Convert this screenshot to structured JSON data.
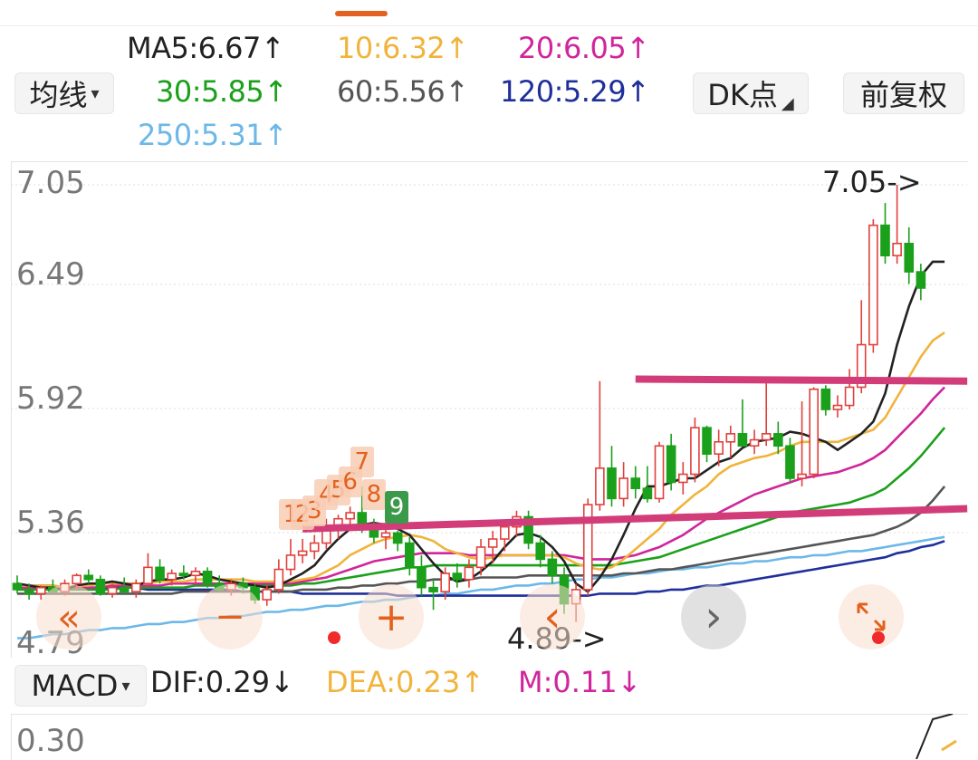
{
  "toolbar": {
    "ma_type_label": "均线",
    "dk_label": "DK点",
    "adjust_label": "前复权"
  },
  "ma_legend": [
    {
      "label": "MA5:6.67↑",
      "color": "#222222"
    },
    {
      "label": "10:6.32↑",
      "color": "#f0b43c"
    },
    {
      "label": "20:6.05↑",
      "color": "#d0259c"
    },
    {
      "label": "30:5.85↑",
      "color": "#1aa01a"
    },
    {
      "label": "60:5.56↑",
      "color": "#555555"
    },
    {
      "label": "120:5.29↑",
      "color": "#1f2f9a"
    },
    {
      "label": "250:5.31↑",
      "color": "#6cb8e8"
    }
  ],
  "price_axis": {
    "ticks": [
      "7.05",
      "6.49",
      "5.92",
      "5.36",
      "4.79"
    ]
  },
  "annotations": {
    "high_label": "7.05->",
    "low_label": "4.89->"
  },
  "td_count_labels": [
    "1",
    "2",
    "3",
    "4",
    "5",
    "6",
    "7",
    "8"
  ],
  "td_sell_label": "9",
  "overlay_controls": {
    "rewind_icon": "«",
    "minus_icon": "−",
    "plus_icon": "+",
    "prev_icon": "‹",
    "next_icon": "›"
  },
  "macd": {
    "indicator_label": "MACD",
    "dif_label": "DIF:0.29↓",
    "dea_label": "DEA:0.23↑",
    "m_label": "M:0.11↓",
    "axis_top": "0.30"
  },
  "colors": {
    "up": "#e0403c",
    "down": "#1aa01a",
    "trendline": "#d23c78",
    "accent": "#e2611e"
  },
  "chart_data": {
    "type": "candlestick",
    "y_range": [
      4.79,
      7.05
    ],
    "grid": true,
    "candles": [
      {
        "o": 5.08,
        "h": 5.12,
        "l": 5.03,
        "c": 5.05
      },
      {
        "o": 5.05,
        "h": 5.08,
        "l": 5.0,
        "c": 5.03
      },
      {
        "o": 5.03,
        "h": 5.07,
        "l": 5.0,
        "c": 5.06
      },
      {
        "o": 5.06,
        "h": 5.1,
        "l": 5.04,
        "c": 5.04
      },
      {
        "o": 5.04,
        "h": 5.1,
        "l": 5.02,
        "c": 5.08
      },
      {
        "o": 5.08,
        "h": 5.13,
        "l": 5.05,
        "c": 5.12
      },
      {
        "o": 5.12,
        "h": 5.15,
        "l": 5.08,
        "c": 5.1
      },
      {
        "o": 5.1,
        "h": 5.12,
        "l": 5.02,
        "c": 5.03
      },
      {
        "o": 5.03,
        "h": 5.08,
        "l": 5.01,
        "c": 5.06
      },
      {
        "o": 5.06,
        "h": 5.11,
        "l": 5.03,
        "c": 5.04
      },
      {
        "o": 5.04,
        "h": 5.1,
        "l": 5.01,
        "c": 5.08
      },
      {
        "o": 5.08,
        "h": 5.23,
        "l": 5.06,
        "c": 5.16
      },
      {
        "o": 5.16,
        "h": 5.2,
        "l": 5.08,
        "c": 5.1
      },
      {
        "o": 5.1,
        "h": 5.15,
        "l": 5.07,
        "c": 5.13
      },
      {
        "o": 5.13,
        "h": 5.17,
        "l": 5.1,
        "c": 5.12
      },
      {
        "o": 5.12,
        "h": 5.16,
        "l": 5.08,
        "c": 5.14
      },
      {
        "o": 5.14,
        "h": 5.16,
        "l": 5.06,
        "c": 5.08
      },
      {
        "o": 5.08,
        "h": 5.12,
        "l": 5.04,
        "c": 5.05
      },
      {
        "o": 5.05,
        "h": 5.1,
        "l": 5.02,
        "c": 5.08
      },
      {
        "o": 5.08,
        "h": 5.11,
        "l": 5.03,
        "c": 5.06
      },
      {
        "o": 5.06,
        "h": 5.08,
        "l": 4.98,
        "c": 5.0
      },
      {
        "o": 5.0,
        "h": 5.07,
        "l": 4.97,
        "c": 5.05
      },
      {
        "o": 5.05,
        "h": 5.2,
        "l": 5.03,
        "c": 5.15
      },
      {
        "o": 5.15,
        "h": 5.3,
        "l": 5.12,
        "c": 5.22
      },
      {
        "o": 5.22,
        "h": 5.3,
        "l": 5.18,
        "c": 5.24
      },
      {
        "o": 5.24,
        "h": 5.32,
        "l": 5.2,
        "c": 5.28
      },
      {
        "o": 5.28,
        "h": 5.4,
        "l": 5.25,
        "c": 5.36
      },
      {
        "o": 5.36,
        "h": 5.42,
        "l": 5.3,
        "c": 5.4
      },
      {
        "o": 5.4,
        "h": 5.46,
        "l": 5.34,
        "c": 5.43
      },
      {
        "o": 5.43,
        "h": 5.56,
        "l": 5.33,
        "c": 5.36
      },
      {
        "o": 5.36,
        "h": 5.4,
        "l": 5.28,
        "c": 5.31
      },
      {
        "o": 5.31,
        "h": 5.36,
        "l": 5.25,
        "c": 5.33
      },
      {
        "o": 5.33,
        "h": 5.34,
        "l": 5.24,
        "c": 5.28
      },
      {
        "o": 5.28,
        "h": 5.31,
        "l": 5.12,
        "c": 5.16
      },
      {
        "o": 5.16,
        "h": 5.22,
        "l": 5.02,
        "c": 5.06
      },
      {
        "o": 5.06,
        "h": 5.1,
        "l": 4.95,
        "c": 5.04
      },
      {
        "o": 5.04,
        "h": 5.16,
        "l": 5.0,
        "c": 5.13
      },
      {
        "o": 5.13,
        "h": 5.18,
        "l": 5.06,
        "c": 5.1
      },
      {
        "o": 5.1,
        "h": 5.2,
        "l": 5.06,
        "c": 5.16
      },
      {
        "o": 5.16,
        "h": 5.3,
        "l": 5.12,
        "c": 5.26
      },
      {
        "o": 5.26,
        "h": 5.34,
        "l": 5.18,
        "c": 5.3
      },
      {
        "o": 5.3,
        "h": 5.38,
        "l": 5.24,
        "c": 5.36
      },
      {
        "o": 5.36,
        "h": 5.44,
        "l": 5.31,
        "c": 5.41
      },
      {
        "o": 5.41,
        "h": 5.44,
        "l": 5.25,
        "c": 5.28
      },
      {
        "o": 5.28,
        "h": 5.32,
        "l": 5.16,
        "c": 5.2
      },
      {
        "o": 5.2,
        "h": 5.24,
        "l": 5.08,
        "c": 5.12
      },
      {
        "o": 5.12,
        "h": 5.16,
        "l": 4.93,
        "c": 4.98
      },
      {
        "o": 4.98,
        "h": 5.08,
        "l": 4.89,
        "c": 5.05
      },
      {
        "o": 5.05,
        "h": 5.5,
        "l": 5.02,
        "c": 5.47
      },
      {
        "o": 5.47,
        "h": 6.08,
        "l": 5.44,
        "c": 5.65
      },
      {
        "o": 5.65,
        "h": 5.76,
        "l": 5.46,
        "c": 5.5
      },
      {
        "o": 5.5,
        "h": 5.68,
        "l": 5.46,
        "c": 5.6
      },
      {
        "o": 5.6,
        "h": 5.66,
        "l": 5.5,
        "c": 5.55
      },
      {
        "o": 5.55,
        "h": 5.66,
        "l": 5.48,
        "c": 5.5
      },
      {
        "o": 5.5,
        "h": 5.78,
        "l": 5.48,
        "c": 5.76
      },
      {
        "o": 5.76,
        "h": 5.82,
        "l": 5.54,
        "c": 5.58
      },
      {
        "o": 5.58,
        "h": 5.68,
        "l": 5.52,
        "c": 5.62
      },
      {
        "o": 5.62,
        "h": 5.9,
        "l": 5.58,
        "c": 5.85
      },
      {
        "o": 5.85,
        "h": 5.86,
        "l": 5.68,
        "c": 5.72
      },
      {
        "o": 5.72,
        "h": 5.84,
        "l": 5.66,
        "c": 5.78
      },
      {
        "o": 5.78,
        "h": 5.86,
        "l": 5.7,
        "c": 5.82
      },
      {
        "o": 5.82,
        "h": 5.99,
        "l": 5.76,
        "c": 5.76
      },
      {
        "o": 5.76,
        "h": 5.84,
        "l": 5.72,
        "c": 5.79
      },
      {
        "o": 5.79,
        "h": 6.08,
        "l": 5.76,
        "c": 5.82
      },
      {
        "o": 5.82,
        "h": 5.88,
        "l": 5.72,
        "c": 5.76
      },
      {
        "o": 5.76,
        "h": 5.8,
        "l": 5.58,
        "c": 5.6
      },
      {
        "o": 5.6,
        "h": 5.98,
        "l": 5.56,
        "c": 5.62
      },
      {
        "o": 5.62,
        "h": 6.05,
        "l": 5.6,
        "c": 6.04
      },
      {
        "o": 6.04,
        "h": 6.06,
        "l": 5.91,
        "c": 5.94
      },
      {
        "o": 5.94,
        "h": 6.01,
        "l": 5.9,
        "c": 5.96
      },
      {
        "o": 5.96,
        "h": 6.14,
        "l": 5.94,
        "c": 6.05
      },
      {
        "o": 6.05,
        "h": 6.48,
        "l": 6.02,
        "c": 6.26
      },
      {
        "o": 6.26,
        "h": 6.88,
        "l": 6.22,
        "c": 6.85
      },
      {
        "o": 6.85,
        "h": 6.96,
        "l": 6.66,
        "c": 6.7
      },
      {
        "o": 6.7,
        "h": 7.05,
        "l": 6.66,
        "c": 6.76
      },
      {
        "o": 6.76,
        "h": 6.84,
        "l": 6.56,
        "c": 6.62
      },
      {
        "o": 6.62,
        "h": 6.66,
        "l": 6.48,
        "c": 6.54
      }
    ],
    "td_setup": {
      "count_start_index": 23,
      "sell_nine_index": 31
    },
    "high": {
      "index": 75,
      "value": 7.05
    },
    "low": {
      "index": 47,
      "value": 4.89
    },
    "trendlines": [
      {
        "from": {
          "index": 24,
          "value": 5.35
        },
        "to": {
          "index": 78,
          "value": 5.45
        }
      },
      {
        "from": {
          "index": 52,
          "value": 6.09
        },
        "to": {
          "index": 78,
          "value": 6.08
        }
      }
    ],
    "series": [
      {
        "name": "MA5",
        "color": "#222222",
        "values": [
          5.08,
          5.07,
          5.06,
          5.06,
          5.05,
          5.07,
          5.08,
          5.08,
          5.09,
          5.08,
          5.07,
          5.09,
          5.1,
          5.1,
          5.11,
          5.13,
          5.12,
          5.1,
          5.09,
          5.08,
          5.07,
          5.06,
          5.07,
          5.1,
          5.13,
          5.17,
          5.24,
          5.3,
          5.35,
          5.37,
          5.38,
          5.37,
          5.35,
          5.32,
          5.25,
          5.18,
          5.12,
          5.09,
          5.1,
          5.14,
          5.19,
          5.26,
          5.32,
          5.33,
          5.31,
          5.26,
          5.19,
          5.08,
          5.04,
          5.11,
          5.2,
          5.32,
          5.45,
          5.56,
          5.56,
          5.58,
          5.6,
          5.6,
          5.64,
          5.68,
          5.7,
          5.75,
          5.78,
          5.79,
          5.8,
          5.83,
          5.82,
          5.8,
          5.78,
          5.74,
          5.78,
          5.82,
          5.88,
          6.02,
          6.26,
          6.45,
          6.6,
          6.67,
          6.67
        ]
      },
      {
        "name": "10",
        "color": "#f0b43c",
        "values": [
          5.07,
          5.07,
          5.07,
          5.07,
          5.06,
          5.07,
          5.07,
          5.08,
          5.08,
          5.08,
          5.08,
          5.08,
          5.09,
          5.09,
          5.09,
          5.1,
          5.1,
          5.1,
          5.1,
          5.1,
          5.09,
          5.09,
          5.09,
          5.09,
          5.1,
          5.11,
          5.14,
          5.17,
          5.22,
          5.25,
          5.28,
          5.3,
          5.31,
          5.32,
          5.31,
          5.29,
          5.25,
          5.23,
          5.21,
          5.2,
          5.21,
          5.22,
          5.22,
          5.22,
          5.22,
          5.22,
          5.21,
          5.18,
          5.16,
          5.15,
          5.16,
          5.2,
          5.25,
          5.3,
          5.35,
          5.42,
          5.47,
          5.52,
          5.56,
          5.62,
          5.66,
          5.68,
          5.7,
          5.71,
          5.73,
          5.76,
          5.78,
          5.78,
          5.78,
          5.78,
          5.8,
          5.82,
          5.84,
          5.9,
          6.0,
          6.1,
          6.2,
          6.28,
          6.32
        ]
      },
      {
        "name": "20",
        "color": "#d0259c",
        "values": [
          5.06,
          5.06,
          5.06,
          5.06,
          5.06,
          5.06,
          5.06,
          5.06,
          5.07,
          5.07,
          5.07,
          5.07,
          5.07,
          5.08,
          5.08,
          5.08,
          5.08,
          5.08,
          5.08,
          5.08,
          5.08,
          5.08,
          5.08,
          5.08,
          5.09,
          5.1,
          5.11,
          5.13,
          5.15,
          5.17,
          5.19,
          5.2,
          5.21,
          5.22,
          5.23,
          5.23,
          5.23,
          5.23,
          5.22,
          5.22,
          5.22,
          5.22,
          5.22,
          5.22,
          5.22,
          5.22,
          5.22,
          5.21,
          5.2,
          5.2,
          5.2,
          5.21,
          5.22,
          5.24,
          5.26,
          5.29,
          5.32,
          5.36,
          5.4,
          5.43,
          5.46,
          5.49,
          5.52,
          5.54,
          5.56,
          5.58,
          5.6,
          5.61,
          5.62,
          5.63,
          5.65,
          5.67,
          5.7,
          5.74,
          5.8,
          5.86,
          5.92,
          5.99,
          6.05
        ]
      },
      {
        "name": "30",
        "color": "#1aa01a",
        "values": [
          5.05,
          5.05,
          5.05,
          5.05,
          5.05,
          5.05,
          5.05,
          5.05,
          5.05,
          5.06,
          5.06,
          5.06,
          5.06,
          5.06,
          5.06,
          5.07,
          5.07,
          5.07,
          5.07,
          5.07,
          5.07,
          5.07,
          5.07,
          5.07,
          5.08,
          5.08,
          5.09,
          5.1,
          5.11,
          5.12,
          5.13,
          5.14,
          5.15,
          5.16,
          5.16,
          5.17,
          5.17,
          5.17,
          5.17,
          5.17,
          5.17,
          5.17,
          5.17,
          5.17,
          5.17,
          5.17,
          5.17,
          5.17,
          5.17,
          5.17,
          5.17,
          5.18,
          5.19,
          5.2,
          5.21,
          5.23,
          5.25,
          5.27,
          5.29,
          5.31,
          5.33,
          5.35,
          5.37,
          5.39,
          5.41,
          5.43,
          5.44,
          5.45,
          5.46,
          5.47,
          5.48,
          5.5,
          5.52,
          5.55,
          5.6,
          5.65,
          5.71,
          5.78,
          5.85
        ]
      },
      {
        "name": "60",
        "color": "#555555",
        "values": [
          5.03,
          5.03,
          5.03,
          5.03,
          5.03,
          5.03,
          5.03,
          5.03,
          5.03,
          5.03,
          5.03,
          5.03,
          5.03,
          5.03,
          5.04,
          5.04,
          5.04,
          5.04,
          5.04,
          5.04,
          5.04,
          5.04,
          5.04,
          5.04,
          5.05,
          5.05,
          5.05,
          5.06,
          5.06,
          5.07,
          5.07,
          5.08,
          5.08,
          5.09,
          5.09,
          5.1,
          5.1,
          5.1,
          5.1,
          5.11,
          5.11,
          5.11,
          5.11,
          5.12,
          5.12,
          5.12,
          5.12,
          5.12,
          5.12,
          5.12,
          5.12,
          5.13,
          5.13,
          5.14,
          5.15,
          5.15,
          5.16,
          5.17,
          5.18,
          5.19,
          5.2,
          5.21,
          5.22,
          5.23,
          5.24,
          5.25,
          5.26,
          5.27,
          5.28,
          5.29,
          5.3,
          5.31,
          5.32,
          5.34,
          5.36,
          5.39,
          5.43,
          5.49,
          5.56
        ]
      },
      {
        "name": "120",
        "color": "#1f2f9a",
        "values": [
          5.07,
          5.07,
          5.07,
          5.07,
          5.06,
          5.06,
          5.06,
          5.06,
          5.06,
          5.06,
          5.06,
          5.05,
          5.05,
          5.05,
          5.05,
          5.05,
          5.05,
          5.05,
          5.05,
          5.04,
          5.04,
          5.04,
          5.04,
          5.04,
          5.03,
          5.03,
          5.03,
          5.03,
          5.03,
          5.03,
          5.03,
          5.03,
          5.02,
          5.02,
          5.02,
          5.02,
          5.02,
          5.02,
          5.02,
          5.02,
          5.02,
          5.02,
          5.02,
          5.02,
          5.02,
          5.02,
          5.02,
          5.02,
          5.02,
          5.03,
          5.03,
          5.03,
          5.03,
          5.04,
          5.04,
          5.05,
          5.05,
          5.06,
          5.07,
          5.07,
          5.08,
          5.09,
          5.1,
          5.11,
          5.12,
          5.13,
          5.14,
          5.15,
          5.16,
          5.17,
          5.18,
          5.19,
          5.2,
          5.21,
          5.23,
          5.24,
          5.26,
          5.27,
          5.29
        ]
      },
      {
        "name": "250",
        "color": "#6cb8e8",
        "values": [
          4.81,
          4.81,
          4.82,
          4.83,
          4.83,
          4.84,
          4.85,
          4.85,
          4.86,
          4.86,
          4.87,
          4.88,
          4.88,
          4.89,
          4.89,
          4.9,
          4.91,
          4.91,
          4.92,
          4.92,
          4.93,
          4.94,
          4.94,
          4.95,
          4.95,
          4.96,
          4.97,
          4.97,
          4.98,
          4.99,
          4.99,
          5.0,
          5.0,
          5.01,
          5.02,
          5.02,
          5.03,
          5.03,
          5.04,
          5.05,
          5.05,
          5.06,
          5.07,
          5.07,
          5.08,
          5.08,
          5.09,
          5.1,
          5.1,
          5.11,
          5.11,
          5.12,
          5.13,
          5.13,
          5.14,
          5.15,
          5.15,
          5.16,
          5.16,
          5.17,
          5.18,
          5.18,
          5.19,
          5.19,
          5.2,
          5.21,
          5.21,
          5.22,
          5.22,
          5.23,
          5.24,
          5.24,
          5.25,
          5.26,
          5.27,
          5.28,
          5.29,
          5.3,
          5.31
        ]
      }
    ],
    "macd_visible": {
      "y_range_top": 0.3
    }
  }
}
